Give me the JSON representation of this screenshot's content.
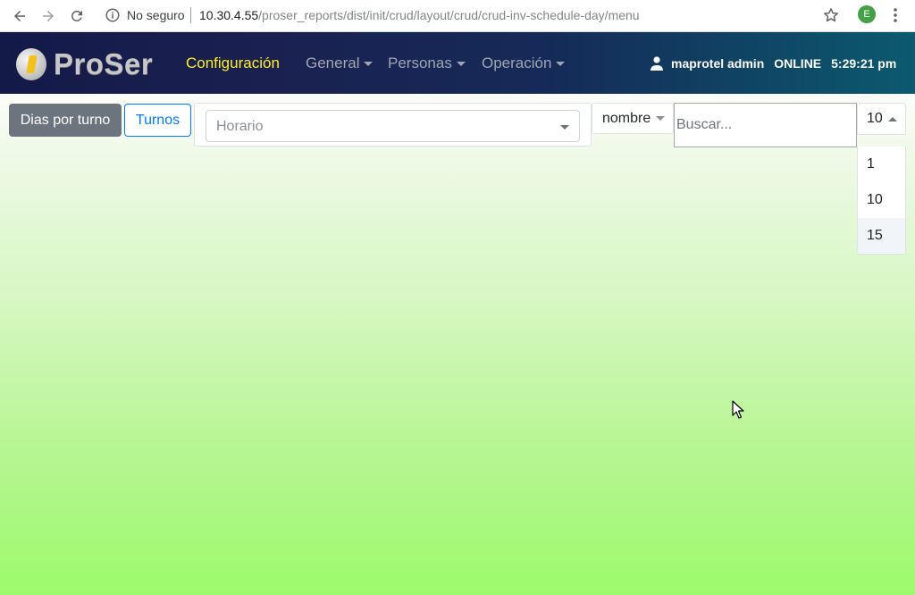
{
  "browser": {
    "security_label": "No seguro",
    "url_host": "10.30.4.55",
    "url_path": "/proser_reports/dist/init/crud/layout/crud/crud-inv-schedule-day/menu",
    "profile_initial": "E"
  },
  "navbar": {
    "logo_text": "ProSer",
    "items": [
      {
        "label": "Configuración",
        "active": true
      },
      {
        "label": "General"
      },
      {
        "label": "Personas"
      },
      {
        "label": "Operación"
      }
    ],
    "user_name": "maprotel admin",
    "status": "ONLINE",
    "time": "5:29:21 pm"
  },
  "toolbar": {
    "dias_label": "Dias por turno",
    "turnos_label": "Turnos",
    "horario_placeholder": "Horario",
    "field_label": "nombre",
    "search_placeholder": "Buscar...",
    "page_size": "10",
    "page_size_options": [
      "1",
      "10",
      "15"
    ]
  },
  "colors": {
    "active_nav": "#ffef2a",
    "primary": "#007bff",
    "secondary": "#6c757d"
  }
}
